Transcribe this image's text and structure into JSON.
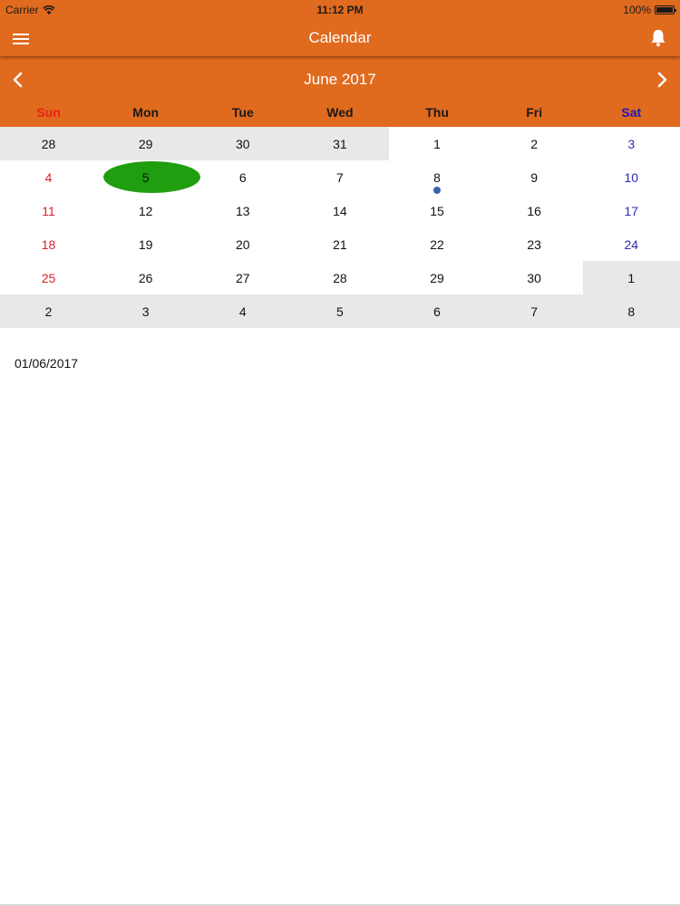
{
  "status_bar": {
    "carrier": "Carrier",
    "time": "11:12 PM",
    "battery": "100%",
    "battery_level": 1.0
  },
  "nav": {
    "title": "Calendar",
    "menu_icon": "hamburger-icon",
    "bell_icon": "bell-icon"
  },
  "calendar": {
    "month_title": "June 2017",
    "prev_icon": "chevron-left-icon",
    "next_icon": "chevron-right-icon",
    "weekdays": [
      "Sun",
      "Mon",
      "Tue",
      "Wed",
      "Thu",
      "Fri",
      "Sat"
    ],
    "weekday_colors": [
      "#e8231a",
      "#1a1a1a",
      "#1a1a1a",
      "#1a1a1a",
      "#1a1a1a",
      "#1a1a1a",
      "#1d1ab4"
    ],
    "weeks": [
      [
        {
          "label": "28",
          "other": true
        },
        {
          "label": "29",
          "other": true
        },
        {
          "label": "30",
          "other": true
        },
        {
          "label": "31",
          "other": true
        },
        {
          "label": "1"
        },
        {
          "label": "2"
        },
        {
          "label": "3"
        }
      ],
      [
        {
          "label": "4"
        },
        {
          "label": "5",
          "selected": true
        },
        {
          "label": "6"
        },
        {
          "label": "7"
        },
        {
          "label": "8",
          "event": true
        },
        {
          "label": "9"
        },
        {
          "label": "10"
        }
      ],
      [
        {
          "label": "11"
        },
        {
          "label": "12"
        },
        {
          "label": "13"
        },
        {
          "label": "14"
        },
        {
          "label": "15"
        },
        {
          "label": "16"
        },
        {
          "label": "17"
        }
      ],
      [
        {
          "label": "18"
        },
        {
          "label": "19"
        },
        {
          "label": "20"
        },
        {
          "label": "21"
        },
        {
          "label": "22"
        },
        {
          "label": "23"
        },
        {
          "label": "24"
        }
      ],
      [
        {
          "label": "25"
        },
        {
          "label": "26"
        },
        {
          "label": "27"
        },
        {
          "label": "28"
        },
        {
          "label": "29"
        },
        {
          "label": "30"
        },
        {
          "label": "1",
          "other": true
        }
      ],
      [
        {
          "label": "2",
          "other": true
        },
        {
          "label": "3",
          "other": true
        },
        {
          "label": "4",
          "other": true
        },
        {
          "label": "5",
          "other": true
        },
        {
          "label": "6",
          "other": true
        },
        {
          "label": "7",
          "other": true
        },
        {
          "label": "8",
          "other": true
        }
      ]
    ],
    "colors": {
      "header": "#e06a1d",
      "sunday": "#d8232a",
      "saturday": "#2a2ab0",
      "selected": "#1f9e10",
      "event_dot": "#3a63a8",
      "other_month_bg": "#e8e8ea"
    }
  },
  "selected_date_text": "01/06/2017"
}
